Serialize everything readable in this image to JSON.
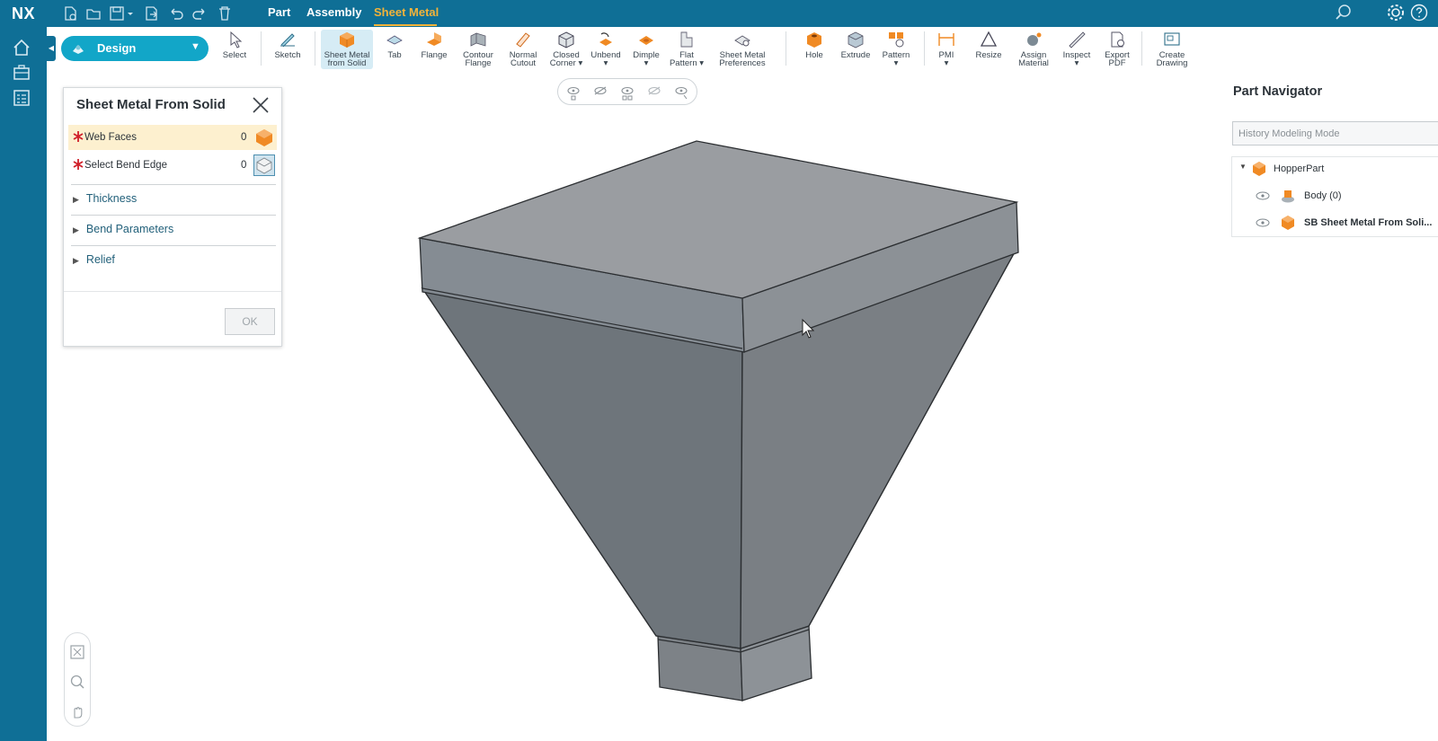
{
  "app": {
    "logo": "NX"
  },
  "top_tabs": [
    {
      "label": "Part",
      "active": false
    },
    {
      "label": "Assembly",
      "active": false
    },
    {
      "label": "Sheet Metal",
      "active": true
    }
  ],
  "mode_selector": {
    "label": "Design"
  },
  "ribbon": {
    "select": "Select",
    "sketch": "Sketch",
    "sheet_metal_from_solid": [
      "Sheet Metal",
      "from Solid"
    ],
    "tab": "Tab",
    "flange": "Flange",
    "contour_flange": [
      "Contour",
      "Flange"
    ],
    "normal_cutout": [
      "Normal",
      "Cutout"
    ],
    "closed_corner": [
      "Closed",
      "Corner ▾"
    ],
    "unbend": "Unbend",
    "dimple": "Dimple",
    "flat_pattern": [
      "Flat",
      "Pattern ▾"
    ],
    "sheet_metal_preferences": [
      "Sheet Metal",
      "Preferences"
    ],
    "hole": "Hole",
    "extrude": "Extrude",
    "pattern": "Pattern",
    "pmi": "PMI",
    "resize": "Resize",
    "assign_material": [
      "Assign",
      "Material"
    ],
    "inspect": "Inspect",
    "export_pdf": [
      "Export",
      "PDF"
    ],
    "create_drawing": [
      "Create",
      "Drawing"
    ]
  },
  "dialog": {
    "title": "Sheet Metal From Solid",
    "web_faces": {
      "label": "Web Faces",
      "count": "0"
    },
    "bend_edge": {
      "label": "Select Bend Edge",
      "count": "0"
    },
    "sections": [
      "Thickness",
      "Bend Parameters",
      "Relief"
    ],
    "ok": "OK"
  },
  "navigator": {
    "title": "Part Navigator",
    "mode": "History Modeling Mode",
    "root": "HopperPart",
    "children": [
      "Body (0)",
      "SB Sheet Metal From Soli..."
    ]
  },
  "colors": {
    "brand": "#0f6f96",
    "active_tab": "#f2b33a",
    "mode_selector": "#12a6c8",
    "highlight_row": "#fdf0cf",
    "part_orange": "#f08a24"
  }
}
